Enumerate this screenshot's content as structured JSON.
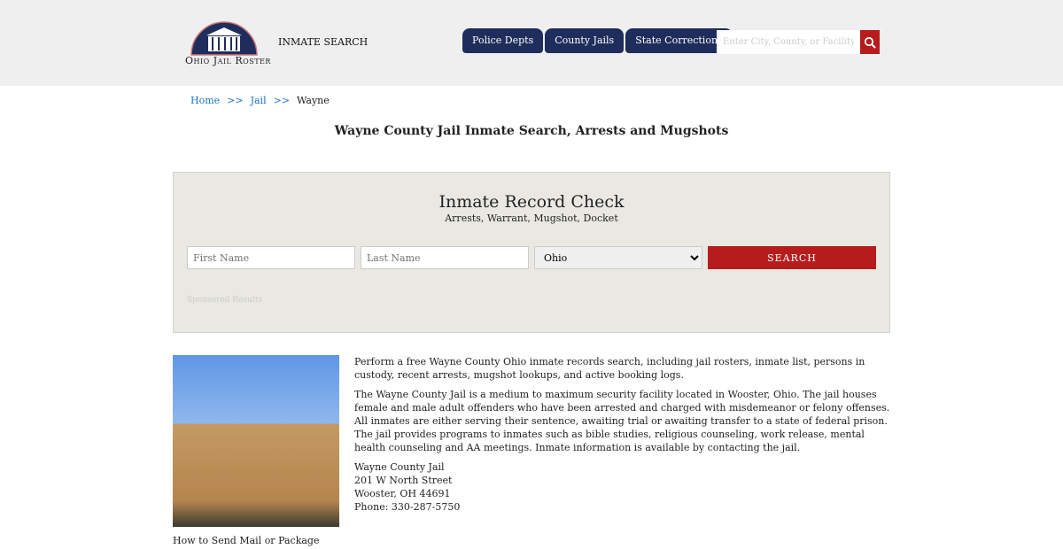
{
  "header": {
    "logo_text": "Ohio Jail Roster",
    "inmate_search": "INMATE SEARCH",
    "nav": [
      "Police Depts",
      "County Jails",
      "State Corrections"
    ],
    "search_placeholder": "Enter City, County, or Facility"
  },
  "breadcrumb": {
    "home": "Home",
    "jail": "Jail",
    "current": "Wayne",
    "sep": ">>"
  },
  "page_title": "Wayne County Jail Inmate Search, Arrests and Mugshots",
  "record_check": {
    "title": "Inmate Record Check",
    "subtitle": "Arrests, Warrant, Mugshot, Docket",
    "first_placeholder": "First Name",
    "last_placeholder": "Last Name",
    "state": "Ohio",
    "button": "SEARCH",
    "sponsored": "Sponsored Results"
  },
  "content": {
    "p1": "Perform a free Wayne County Ohio inmate records search, including jail rosters, inmate list, persons in custody, recent arrests, mugshot lookups, and active booking logs.",
    "p2": "The Wayne County Jail is a medium to maximum security facility located in Wooster, Ohio. The jail houses female and male adult offenders who have been arrested and charged with misdemeanor or felony offenses. All inmates are either serving their sentence, awaiting trial or awaiting transfer to a state of federal prison. The jail provides programs to inmates such as bible studies, religious counseling, work release, mental health counseling and AA meetings. Inmate information is available by contacting the jail.",
    "address": [
      "Wayne County Jail",
      "201 W North Street",
      "Wooster, OH 44691",
      "Phone: 330-287-5750"
    ]
  },
  "caption": "How to Send Mail or Package"
}
